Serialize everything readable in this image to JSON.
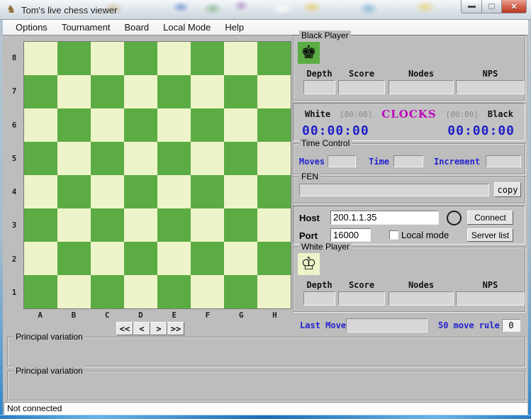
{
  "window": {
    "title": "Tom's live chess viewer",
    "status": "Not connected"
  },
  "icons": {
    "app_knight": "♞",
    "close": "✕",
    "black_king": "♚",
    "white_king": "♔"
  },
  "colors": {
    "blue_label": "#2323ce",
    "clock_blue": "#2020c8",
    "magenta": "#be00be",
    "board_light": "#eef4c9",
    "board_dark": "#5cac44"
  },
  "menu": {
    "items": [
      "Options",
      "Tournament",
      "Board",
      "Local Mode",
      "Help"
    ]
  },
  "board": {
    "files": [
      "A",
      "B",
      "C",
      "D",
      "E",
      "F",
      "G",
      "H"
    ],
    "ranks": [
      "8",
      "7",
      "6",
      "5",
      "4",
      "3",
      "2",
      "1"
    ],
    "colors": {
      "light": "#eef4c9",
      "dark": "#5cac44"
    }
  },
  "nav": {
    "buttons": [
      "<<",
      "<",
      ">",
      ">>"
    ]
  },
  "black_player": {
    "label": "Black Player",
    "stats": [
      "Depth",
      "Score",
      "Nodes",
      "NPS"
    ],
    "depth_value": "",
    "score_value": "",
    "nodes_value": "",
    "nps_value": ""
  },
  "white_player": {
    "label": "White Player",
    "stats": [
      "Depth",
      "Score",
      "Nodes",
      "NPS"
    ],
    "depth_value": "",
    "score_value": "",
    "nodes_value": "",
    "nps_value": ""
  },
  "clocks": {
    "title": "CLOCKS",
    "white_label": "White",
    "black_label": "Black",
    "white_bracket": "[00:00]",
    "black_bracket": "[00:00]",
    "white_time": "00:00:00",
    "black_time": "00:00:00"
  },
  "time_control": {
    "label": "Time Control",
    "moves_label": "Moves",
    "moves_value": "",
    "time_label": "Time",
    "time_value": "",
    "increment_label": "Increment",
    "increment_value": ""
  },
  "fen": {
    "label": "FEN",
    "value": "",
    "copy_label": "copy"
  },
  "connection": {
    "host_label": "Host",
    "host_value": "200.1.1.35",
    "port_label": "Port",
    "port_value": "16000",
    "local_mode_label": "Local mode",
    "local_mode_checked": false,
    "connect_label": "Connect",
    "server_list_label": "Server list"
  },
  "last_move": {
    "label": "Last Move",
    "value": "",
    "rule_label": "50 move rule",
    "rule_value": "0"
  },
  "variations": [
    {
      "label": "Principal variation",
      "value": ""
    },
    {
      "label": "Principal variation",
      "value": ""
    }
  ]
}
